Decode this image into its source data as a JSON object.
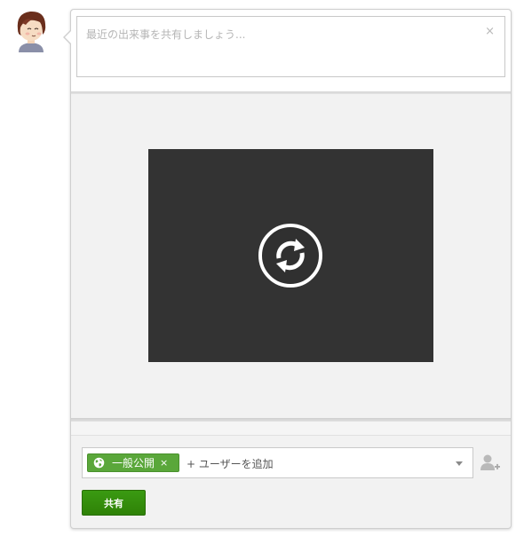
{
  "user": {
    "avatar_icon": "cartoon-face-avatar"
  },
  "composer": {
    "placeholder": "最近の出来事を共有しましょう...",
    "close_glyph": "×"
  },
  "media": {
    "state": "loading",
    "icon": "refresh-icon",
    "background": "#333333"
  },
  "audience": {
    "chip_label": "一般公開",
    "chip_icon": "globe-icon",
    "chip_remove": "×",
    "chip_color": "#5aa73a",
    "add_people_text": "+ ユーザーを追加"
  },
  "actions": {
    "share_label": "共有",
    "share_color": "#338a0b",
    "add_person_icon": "add-person-icon"
  }
}
